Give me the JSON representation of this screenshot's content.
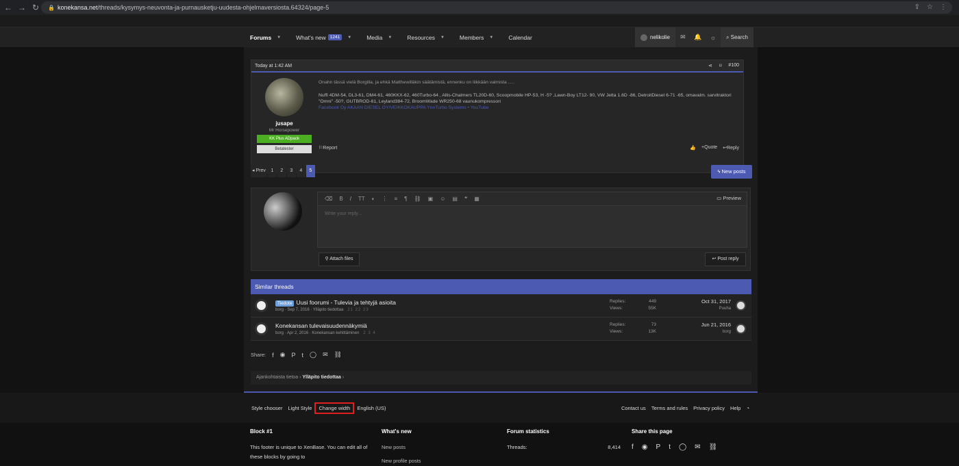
{
  "browser": {
    "host": "konekansa.net",
    "path": "/threads/kysymys-neuvonta-ja-purnausketju-uudesta-ohjelmaversiosta.64324/page-5"
  },
  "nav": {
    "forums": "Forums",
    "whats_new": "What's new",
    "whats_new_count": "1241",
    "media": "Media",
    "resources": "Resources",
    "members": "Members",
    "calendar": "Calendar",
    "username": "nelikolie",
    "search": "Search"
  },
  "post": {
    "time": "Today at 1:42 AM",
    "number": "#100",
    "user": "jusape",
    "user_title": "Mr Horsepower",
    "badge1": "KK Plus ADpack",
    "badge2": "Betatester",
    "message": "Onahn tässä vielä Borgilla, ja ehkä Matthewilläkin säätämistä, ennenku on liikkään valmista .....",
    "signature": "Nuffi 4DM-54, DL3-61, DM4-61, 460KKX-62, 460Turbo-64 , Allis-Chalmers TL20D-60, Scoopmobile HP-53, H -5? ,Lawn-Boy LT12- 90, VW Jetta 1.6D -86, DetroitDiesel 6-71 -65, omavalm. sarvitraktori \"Omni\" -50?, GUTBROD-61, Leyland384-72, BroomWade WR250-68 vaunukompressori",
    "links": "Facebook Oy AKAAN DIESEL OY/VEIKKOKAUPPA YnnTurbo Systems • YouTube",
    "report": "Report",
    "quote": "+Quote",
    "reply": "Reply"
  },
  "pager": {
    "prev": "◂ Prev",
    "pages": [
      "1",
      "2",
      "3",
      "4",
      "5"
    ],
    "new_posts": "New posts"
  },
  "editor": {
    "placeholder": "Write your reply...",
    "preview": "Preview",
    "attach": "Attach files",
    "post_reply": "Post reply"
  },
  "similar": {
    "title": "Similar threads",
    "threads": [
      {
        "tag": "Tiedote",
        "title": "Uusi foorumi - Tulevia ja tehtyjä asioita",
        "meta": "borg · Sep 7, 2016 · Ylläpito tiedottaa",
        "pages": "21 22 23",
        "replies_label": "Replies:",
        "replies": "449",
        "views_label": "Views:",
        "views": "55K",
        "date": "Oct 31, 2017",
        "last_user": "Puuha"
      },
      {
        "tag": "",
        "title": "Konekansan tulevaisuudennäkymiä",
        "meta": "borg · Apr 2, 2016 · Konekansan kehittäminen",
        "pages": "2 3 4",
        "replies_label": "Replies:",
        "replies": "73",
        "views_label": "Views:",
        "views": "13K",
        "date": "Jun 21, 2016",
        "last_user": "borg"
      }
    ]
  },
  "share_label": "Share:",
  "breadcrumb": {
    "parent": "Ajankohtaista tietoa",
    "current": "Ylläpito tiedottaa"
  },
  "footer": {
    "style_chooser": "Style chooser",
    "light_style": "Light Style",
    "change_width": "Change width",
    "language": "English (US)",
    "contact": "Contact us",
    "terms": "Terms and rules",
    "privacy": "Privacy policy",
    "help": "Help",
    "block1_title": "Block #1",
    "block1_text1": "This footer is unique to XenBase. You can edit all of",
    "block1_text2": "these blocks by going to",
    "whats_new_title": "What's new",
    "new_posts": "New posts",
    "new_profile_posts": "New profile posts",
    "stats_title": "Forum statistics",
    "threads_label": "Threads:",
    "threads_value": "8,414",
    "share_title": "Share this page"
  }
}
